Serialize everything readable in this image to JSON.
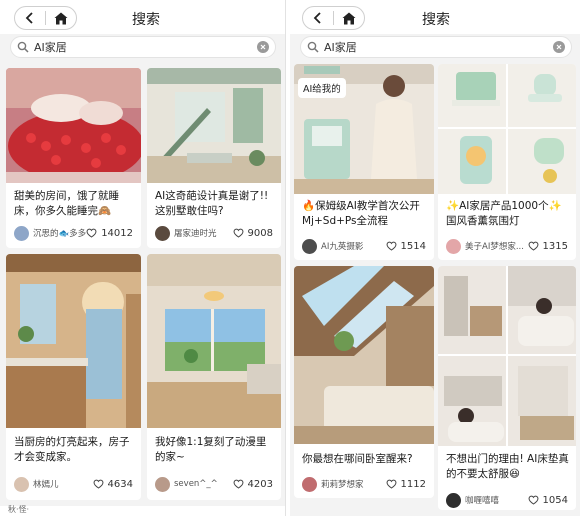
{
  "left": {
    "title": "搜索",
    "search_query": "AI家居",
    "cards": [
      {
        "title": "甜美的房间，饿了就睡床，你多久能睡完🙈",
        "author": "沉思的🐟多多",
        "likes": "14012"
      },
      {
        "title": "AI这奇葩设计真是谢了!!这别墅敢住吗?",
        "author": "屠家迪时光",
        "likes": "9008"
      },
      {
        "title": "当厨房的灯亮起来，房子才会变成家。",
        "author": "林嫣儿",
        "likes": "4634"
      },
      {
        "title": "我好像1:1复刻了动漫里的家~",
        "author": "seven^_^",
        "likes": "4203"
      }
    ],
    "partial_text": "秋·怪·"
  },
  "right": {
    "title": "搜索",
    "search_query": "AI家居",
    "cards": [
      {
        "badge": "AI给我的",
        "title": "🔥保姆级AI教学首次公开Mj+Sd+Ps全流程",
        "author": "AI九英摄影",
        "likes": "1514"
      },
      {
        "title": "✨AI家居产品1000个✨国风香薰氛围灯",
        "author": "美子AI梦想家...",
        "likes": "1315"
      },
      {
        "title": "你最想在哪间卧室醒来?",
        "author": "莉莉梦想家",
        "likes": "1112"
      },
      {
        "title": "不想出门的理由! AI床垫真的不要太舒服😆",
        "author": "咖喱嘻嘻",
        "likes": "1054"
      }
    ]
  },
  "icons": {
    "back": "chevron-left-icon",
    "home": "home-icon",
    "search": "search-icon",
    "clear": "clear-icon",
    "like": "heart-outline-icon"
  }
}
